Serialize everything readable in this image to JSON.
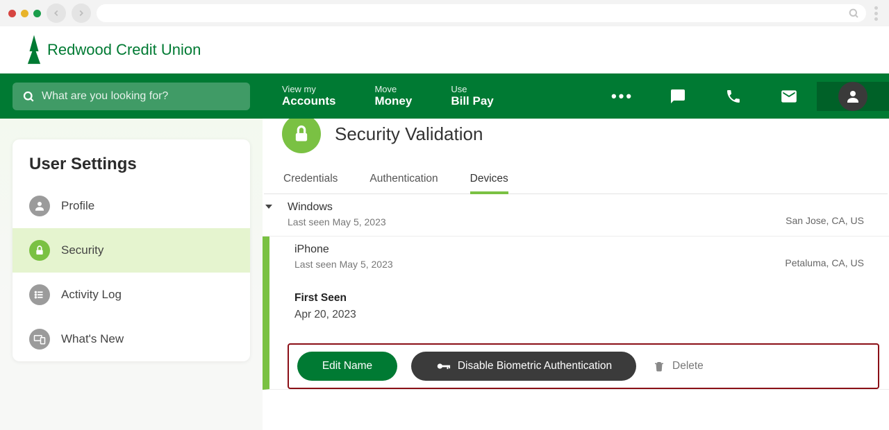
{
  "brand": "Redwood Credit Union",
  "search_placeholder": "What are you looking for?",
  "topnav": [
    {
      "small": "View my",
      "big": "Accounts"
    },
    {
      "small": "Move",
      "big": "Money"
    },
    {
      "small": "Use",
      "big": "Bill Pay"
    }
  ],
  "sidebar": {
    "title": "User Settings",
    "items": [
      {
        "label": "Profile"
      },
      {
        "label": "Security"
      },
      {
        "label": "Activity Log"
      },
      {
        "label": "What's New"
      }
    ]
  },
  "page_title": "Security Validation",
  "tabs": [
    {
      "label": "Credentials"
    },
    {
      "label": "Authentication"
    },
    {
      "label": "Devices"
    }
  ],
  "devices": [
    {
      "name": "Windows",
      "last_seen": "Last seen May 5, 2023",
      "location": "San Jose, CA, US"
    },
    {
      "name": "iPhone",
      "last_seen": "Last seen May 5, 2023",
      "location": "Petaluma, CA, US"
    }
  ],
  "first_seen": {
    "label": "First Seen",
    "value": "Apr 20, 2023"
  },
  "actions": {
    "edit": "Edit Name",
    "disable_bio": "Disable Biometric Authentication",
    "delete": "Delete"
  }
}
